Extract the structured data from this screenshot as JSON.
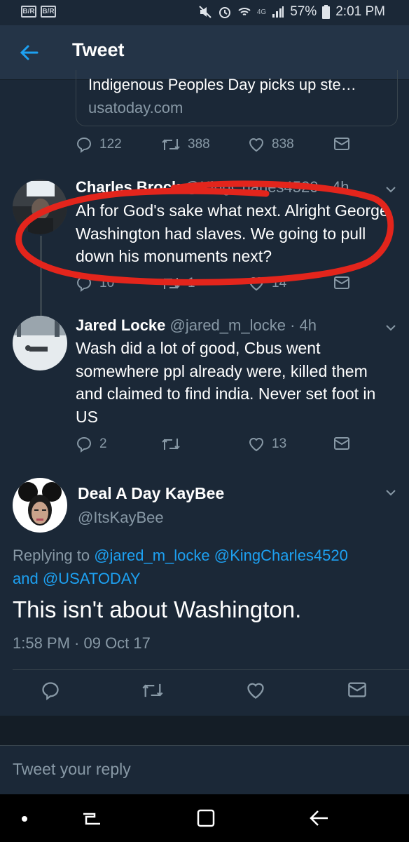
{
  "status_bar": {
    "left_apps": [
      "B/R",
      "B/R"
    ],
    "network": "4G",
    "battery": "57%",
    "time": "2:01 PM"
  },
  "header": {
    "title": "Tweet"
  },
  "quoted_card": {
    "title": "Indigenous Peoples Day picks up ste…",
    "domain": "usatoday.com"
  },
  "parent_actions": {
    "replies": "122",
    "retweets": "388",
    "likes": "838"
  },
  "replies": [
    {
      "name": "Charles Brock",
      "handle": "@KingCharles4520",
      "time": "· 4h",
      "text": "Ah for God's sake what next. Alright George Washington had slaves. We going to pull down his monuments next?",
      "replies_count": "10",
      "retweets_count": "1",
      "likes_count": "14"
    },
    {
      "name": "Jared Locke",
      "handle": "@jared_m_locke",
      "time": "· 4h",
      "text": "Wash did a lot of good, Cbus went somewhere ppl already were, killed them and claimed to find india. Never set foot in US",
      "replies_count": "2",
      "retweets_count": "",
      "likes_count": "13"
    }
  ],
  "main_tweet": {
    "name": "Deal A Day KayBee",
    "handle": "@ItsKayBee",
    "replying_prefix": "Replying to",
    "replying_to": [
      "@jared_m_locke",
      "@KingCharles4520"
    ],
    "replying_and": "and",
    "replying_last": "@USATODAY",
    "text": "This isn't about Washington.",
    "timestamp": "1:58 PM · 09 Oct 17"
  },
  "reply_box": {
    "placeholder": "Tweet your reply"
  },
  "colors": {
    "background": "#1b2837",
    "header": "#243447",
    "link": "#1da1f2",
    "muted": "#8899a6",
    "annotation": "#e3251c"
  }
}
